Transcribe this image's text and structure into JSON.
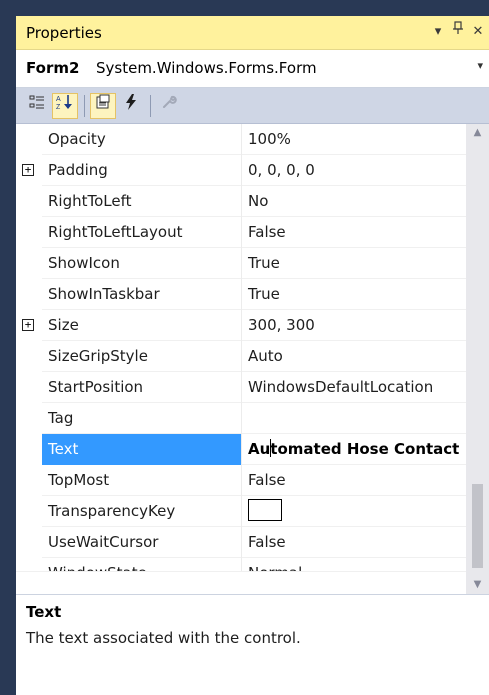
{
  "window": {
    "title": "Properties",
    "dropdown_glyph": "▾",
    "pin_glyph": "ᵖ",
    "close_glyph": "✕"
  },
  "object_selector": {
    "name": "Form2",
    "type": "System.Windows.Forms.Form",
    "dropdown_glyph": "▾"
  },
  "toolbar": {
    "categorized_icon": "categorized-icon",
    "alphabetical_icon": "alphabetical-icon",
    "properties_icon": "properties-icon",
    "events_icon": "events-icon",
    "property_pages_icon": "property-pages-icon",
    "glyphs": {
      "categorized": "▤",
      "alphabetical": "↓",
      "properties": "⊡",
      "events": "⚡",
      "property_pages": "🔧"
    }
  },
  "properties": [
    {
      "name": "Opacity",
      "value": "100%"
    },
    {
      "name": "Padding",
      "value": "0, 0, 0, 0",
      "expandable": true
    },
    {
      "name": "RightToLeft",
      "value": "No"
    },
    {
      "name": "RightToLeftLayout",
      "value": "False"
    },
    {
      "name": "ShowIcon",
      "value": "True"
    },
    {
      "name": "ShowInTaskbar",
      "value": "True"
    },
    {
      "name": "Size",
      "value": "300, 300",
      "expandable": true
    },
    {
      "name": "SizeGripStyle",
      "value": "Auto"
    },
    {
      "name": "StartPosition",
      "value": "WindowsDefaultLocation"
    },
    {
      "name": "Tag",
      "value": ""
    },
    {
      "name": "Text",
      "value_before_caret": "Au",
      "value_after_caret": "tomated Hose Contact",
      "selected": true
    },
    {
      "name": "TopMost",
      "value": "False"
    },
    {
      "name": "TransparencyKey",
      "value": "",
      "color_swatch": "#ffffff"
    },
    {
      "name": "UseWaitCursor",
      "value": "False"
    },
    {
      "name": "WindowState",
      "value": "Normal",
      "partially_visible": true
    }
  ],
  "expander_glyph": "+",
  "scrollbar": {
    "up_glyph": "▲",
    "down_glyph": "▼"
  },
  "description": {
    "title": "Text",
    "text": "The text associated with the control."
  },
  "colors": {
    "title_bar": "#FFF29D",
    "toolbar": "#CFD6E5",
    "selection": "#3399FF",
    "frame": "#293955"
  }
}
